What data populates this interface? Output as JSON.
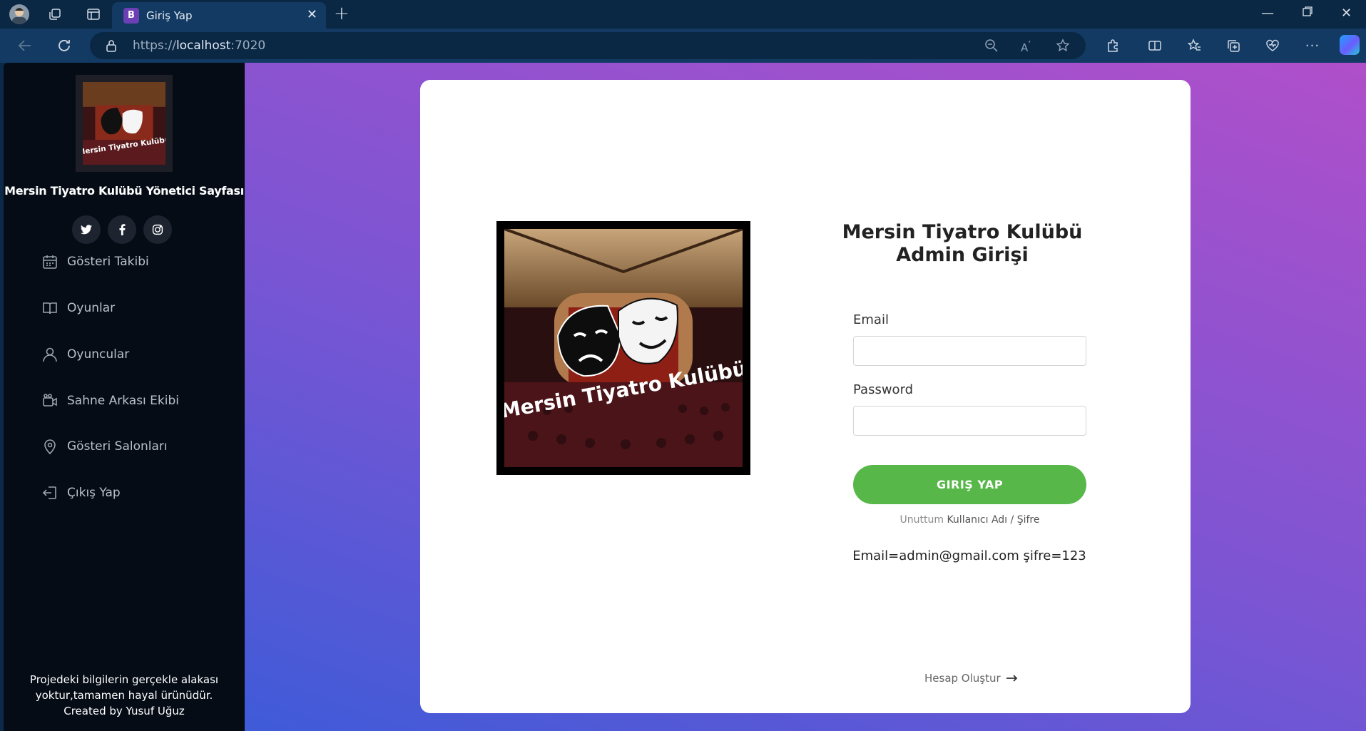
{
  "browser": {
    "tab_title": "Giriş Yap",
    "tab_favicon": "B",
    "url_prefix": "https://",
    "url_host": "localhost",
    "url_port": ":7020"
  },
  "sidebar": {
    "title": "Mersin Tiyatro Kulübü Yönetici Sayfası",
    "logo_text": "Mersin Tiyatro Kulübü",
    "socials": [
      "twitter",
      "facebook",
      "instagram"
    ],
    "items": [
      {
        "label": "Gösteri Takibi",
        "icon": "calendar-icon"
      },
      {
        "label": "Oyunlar",
        "icon": "book-icon"
      },
      {
        "label": "Oyuncular",
        "icon": "user-icon"
      },
      {
        "label": "Sahne Arkası Ekibi",
        "icon": "camera-icon"
      },
      {
        "label": "Gösteri Salonları",
        "icon": "map-pin-icon"
      },
      {
        "label": "Çıkış Yap",
        "icon": "logout-icon"
      }
    ],
    "footer_line1": "Projedeki bilgilerin gerçekle alakası",
    "footer_line2": "yoktur,tamamen hayal ürünüdür.",
    "footer_line3": "Created by Yusuf Uğuz"
  },
  "login": {
    "image_text": "Mersin Tiyatro Kulübü",
    "title_line1": "Mersin Tiyatro Kulübü",
    "title_line2": "Admin Girişi",
    "email_label": "Email",
    "email_value": "",
    "password_label": "Password",
    "password_value": "",
    "submit_label": "GIRIŞ YAP",
    "forgot_prefix": "Unuttum",
    "forgot_link": "Kullanıcı Adı / Şifre",
    "hint": "Email=admin@gmail.com şifre=123",
    "create_account": "Hesap Oluştur"
  },
  "colors": {
    "sidebar_bg": "#050c16",
    "button": "#57b849",
    "gradient_start": "#3f5bd8",
    "gradient_end": "#b04fca"
  }
}
